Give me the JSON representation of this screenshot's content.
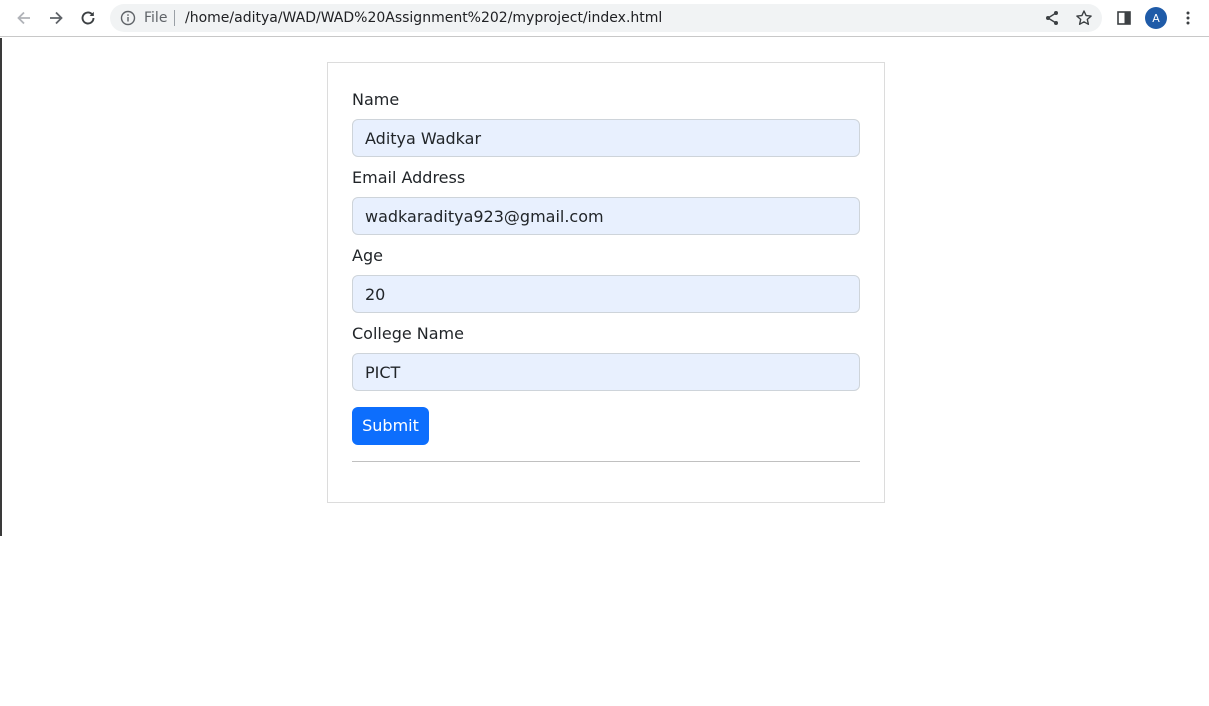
{
  "browser": {
    "scheme_label": "File",
    "url": "/home/aditya/WAD/WAD%20Assignment%202/myproject/index.html",
    "avatar_letter": "A",
    "icons": [
      "back-icon",
      "forward-icon",
      "reload-icon",
      "info-icon",
      "share-icon",
      "star-icon",
      "side-panel-icon",
      "menu-icon"
    ]
  },
  "form": {
    "fields": [
      {
        "label": "Name",
        "value": "Aditya Wadkar"
      },
      {
        "label": "Email Address",
        "value": "wadkaraditya923@gmail.com"
      },
      {
        "label": "Age",
        "value": "20"
      },
      {
        "label": "College Name",
        "value": "PICT"
      }
    ],
    "submit_label": "Submit"
  },
  "colors": {
    "primary": "#0d6efd",
    "field_autofill": "#e8f0fe",
    "avatar": "#1f5ba8"
  }
}
